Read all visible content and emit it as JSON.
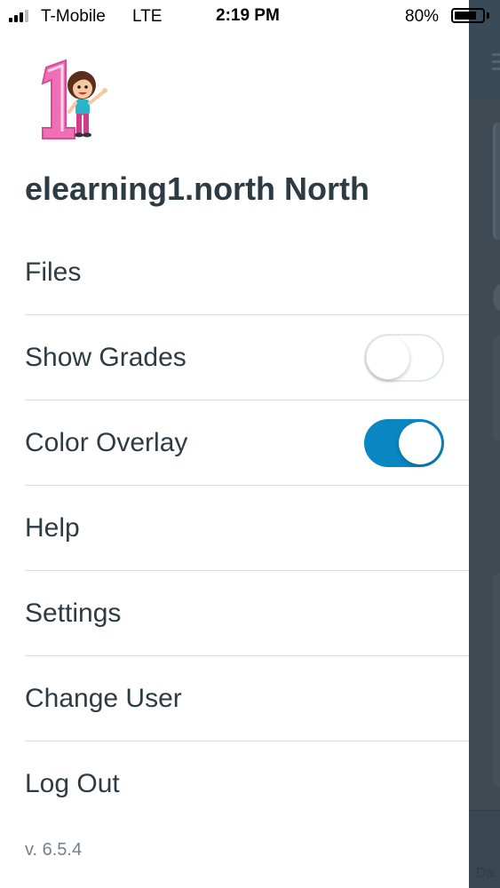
{
  "status_bar": {
    "carrier": "T-Mobile",
    "network": "LTE",
    "time": "2:19 PM",
    "battery_percent": "80%",
    "battery_level": 0.8
  },
  "drawer": {
    "account_name": "elearning1.north North",
    "menu": [
      {
        "label": "Files"
      },
      {
        "label": "Show Grades",
        "toggle": false
      },
      {
        "label": "Color Overlay",
        "toggle": true
      },
      {
        "label": "Help"
      },
      {
        "label": "Settings"
      },
      {
        "label": "Change User"
      },
      {
        "label": "Log Out"
      }
    ],
    "version": "v. 6.5.4"
  },
  "background": {
    "footer_text": "Da"
  },
  "colors": {
    "accent": "#0a86c2",
    "text": "#2d3b45",
    "overlay": "#3f4a52"
  }
}
